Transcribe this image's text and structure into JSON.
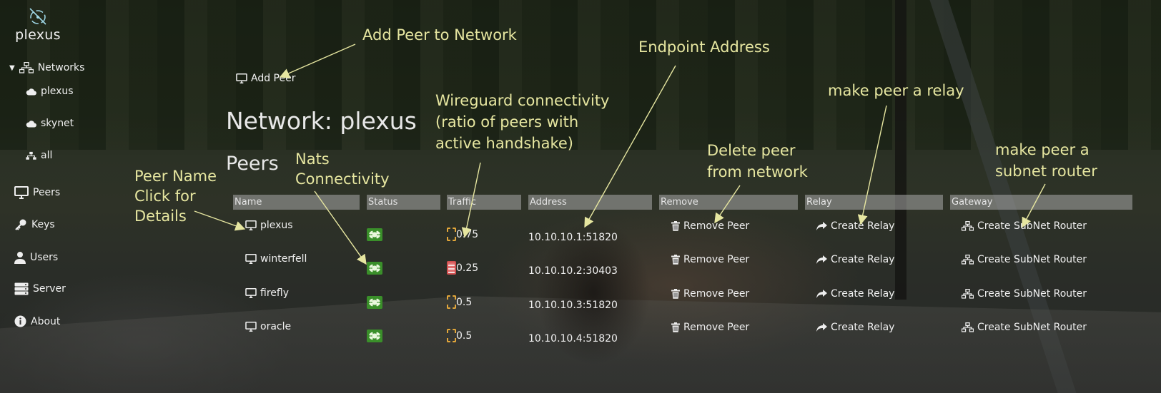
{
  "brand": {
    "name": "plexus"
  },
  "sidebar": {
    "networks_label": "Networks",
    "network_items": [
      "plexus",
      "skynet",
      "all"
    ],
    "peers_label": "Peers",
    "keys_label": "Keys",
    "users_label": "Users",
    "server_label": "Server",
    "about_label": "About"
  },
  "main": {
    "add_peer_label": "Add Peer",
    "network_heading": "Network: plexus",
    "peers_heading": "Peers"
  },
  "table": {
    "headers": [
      "Name",
      "Status",
      "Traffic",
      "Address",
      "Remove",
      "Relay",
      "Gateway"
    ],
    "action_labels": {
      "remove": "Remove Peer",
      "relay": "Create Relay",
      "gateway": "Create SubNet Router"
    },
    "rows": [
      {
        "name": "plexus",
        "traffic": "0.75",
        "traffic_state": "ok",
        "address": "10.10.10.1:51820"
      },
      {
        "name": "winterfell",
        "traffic": "0.25",
        "traffic_state": "bad",
        "address": "10.10.10.2:30403"
      },
      {
        "name": "firefly",
        "traffic": "0.5",
        "traffic_state": "ok",
        "address": "10.10.10.3:51820"
      },
      {
        "name": "oracle",
        "traffic": "0.5",
        "traffic_state": "ok",
        "address": "10.10.10.4:51820"
      }
    ]
  },
  "annotations": {
    "add_peer": "Add Peer to Network",
    "endpoint": "Endpoint Address",
    "wireguard": "Wireguard connectivity\n(ratio of peers with\nactive handshake)",
    "relay": "make peer a relay",
    "peer_name": "Peer Name\nClick for\nDetails",
    "nats": "Nats\nConnectivity",
    "delete": "Delete peer\nfrom network",
    "gateway": "make peer a\nsubnet router"
  },
  "colors": {
    "annotation": "#e6e6a0",
    "header_bg": "#aaaaaa",
    "status_ok": "#3a8f2a",
    "traffic_ok": "#e2a63a",
    "traffic_bad": "#d05050"
  }
}
